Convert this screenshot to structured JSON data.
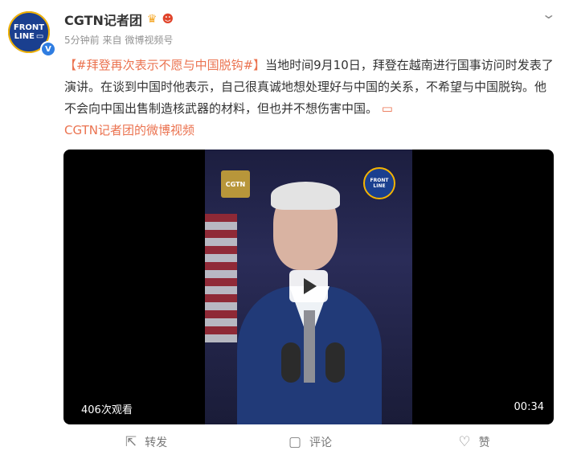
{
  "account": {
    "name": "CGTN记者团",
    "avatar_line1": "FRONT",
    "avatar_line2": "LINE",
    "verified_mark": "V",
    "badge1_icon": "crown-icon",
    "badge2_icon": "mascot-icon"
  },
  "meta": {
    "time": "5分钟前",
    "from_label": "来自",
    "source": "微博视频号"
  },
  "post": {
    "tag": "【#拜登再次表示不愿与中国脱钩#】",
    "text": "当地时间9月10日，拜登在越南进行国事访问时发表了演讲。在谈到中国时他表示，自己很真诚地想处理好与中国的关系，不希望与中国脱钩。他不会向中国出售制造核武器的材料，但也并不想伤害中国。",
    "video_icon": "▭",
    "link_text": "CGTN记者团的微博视频"
  },
  "video": {
    "views": "406次观看",
    "duration": "00:34",
    "logo_left": "CGTN",
    "logo_right_line1": "FRONT",
    "logo_right_line2": "LINE"
  },
  "actions": {
    "repost_label": "转发",
    "comment_label": "评论",
    "like_label": "赞"
  },
  "colors": {
    "accent": "#eb7350",
    "brand_blue": "#1a3f8f"
  }
}
